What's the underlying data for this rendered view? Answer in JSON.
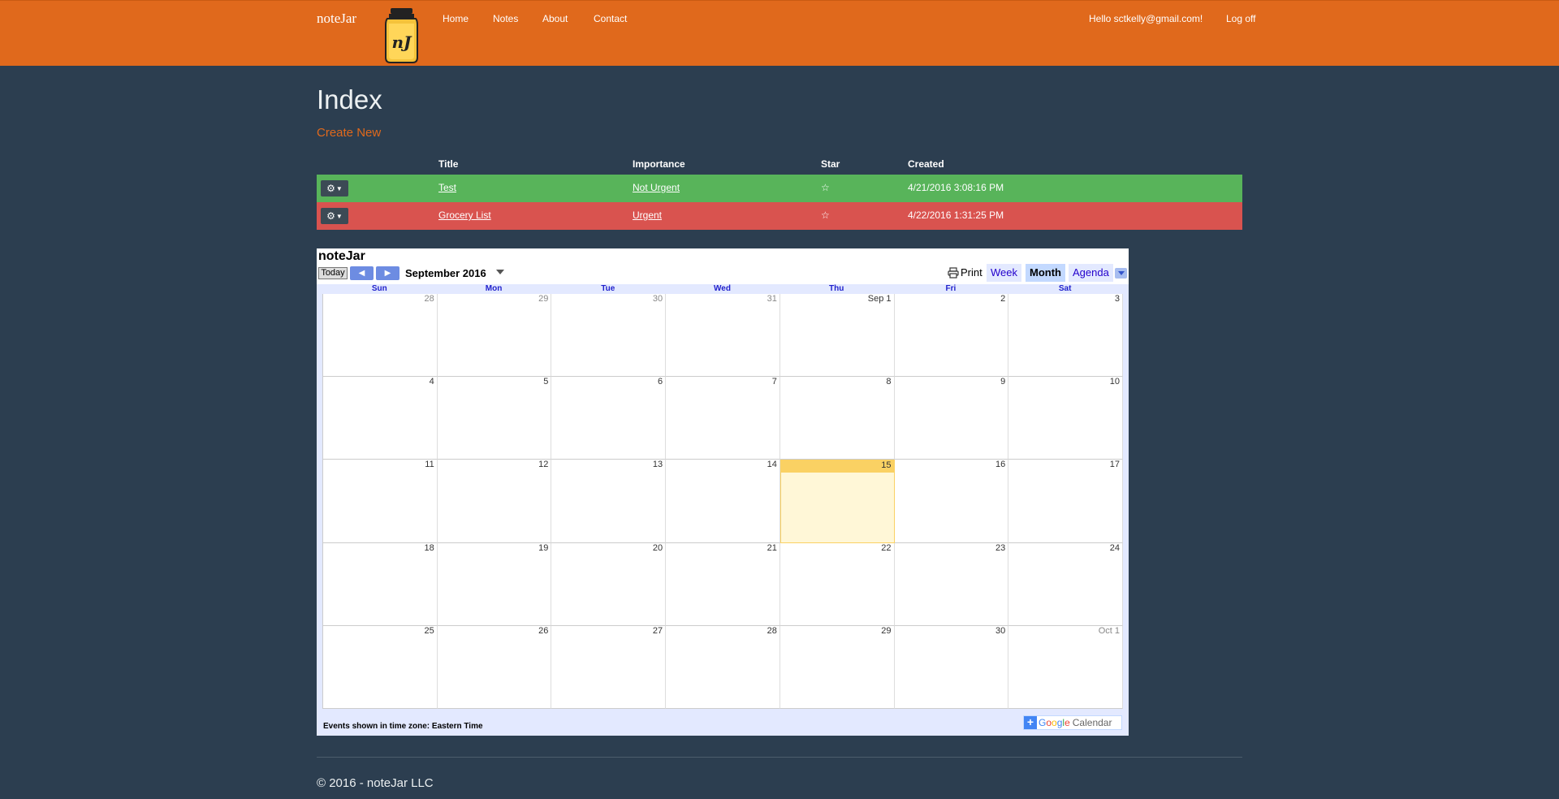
{
  "navbar": {
    "brand": "noteJar",
    "logo_text": "nJ",
    "links": [
      "Home",
      "Notes",
      "About",
      "Contact"
    ],
    "greeting": "Hello sctkelly@gmail.com!",
    "logoff": "Log off",
    "color": "#e0691c"
  },
  "page": {
    "title": "Index",
    "create_new": "Create New"
  },
  "table": {
    "headers": {
      "title": "Title",
      "importance": "Importance",
      "star": "Star",
      "created": "Created"
    },
    "rows": [
      {
        "title": "Test",
        "importance": "Not Urgent",
        "star": "☆",
        "created": "4/21/2016 3:08:16 PM",
        "color": "#58b45a"
      },
      {
        "title": "Grocery List",
        "importance": "Urgent",
        "star": "☆",
        "created": "4/22/2016 1:31:25 PM",
        "color": "#d9534f"
      }
    ],
    "gear_icon": "gear-icon"
  },
  "calendar": {
    "title": "noteJar",
    "today": "Today",
    "month": "September 2016",
    "print": "Print",
    "views": {
      "week": "Week",
      "month": "Month",
      "agenda": "Agenda"
    },
    "active_view": "Month",
    "weekdays": [
      "Sun",
      "Mon",
      "Tue",
      "Wed",
      "Thu",
      "Fri",
      "Sat"
    ],
    "weeks": [
      [
        "28",
        "29",
        "30",
        "31",
        "Sep 1",
        "2",
        "3"
      ],
      [
        "4",
        "5",
        "6",
        "7",
        "8",
        "9",
        "10"
      ],
      [
        "11",
        "12",
        "13",
        "14",
        "15",
        "16",
        "17"
      ],
      [
        "18",
        "19",
        "20",
        "21",
        "22",
        "23",
        "24"
      ],
      [
        "25",
        "26",
        "27",
        "28",
        "29",
        "30",
        "Oct 1"
      ]
    ],
    "today_date": "15",
    "timezone_note": "Events shown in time zone: Eastern Time",
    "google": {
      "letters": [
        "G",
        "o",
        "o",
        "g",
        "l",
        "e"
      ],
      "calendar_word": "Calendar"
    }
  },
  "footer": "© 2016 - noteJar LLC"
}
